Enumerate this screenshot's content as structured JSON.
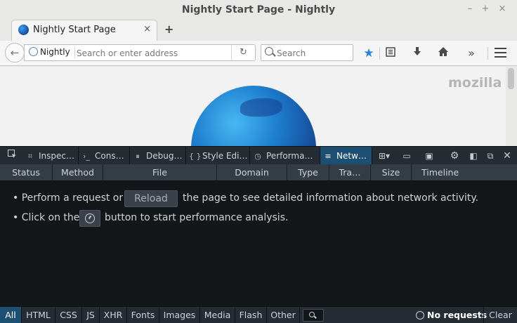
{
  "window": {
    "title": "Nightly Start Page - Nightly",
    "minimize_icon": "–",
    "maximize_icon": "+",
    "close_icon": "×"
  },
  "tabs": [
    {
      "label": "Nightly Start Page",
      "close": "×"
    }
  ],
  "new_tab_icon": "+",
  "navbar": {
    "identity_label": "Nightly",
    "url_placeholder": "Search or enter address",
    "search_placeholder": "Search"
  },
  "content": {
    "brand": "mozilla"
  },
  "devtools": {
    "tabs": [
      {
        "label": "Inspec…",
        "icon": "inspector-icon"
      },
      {
        "label": "Cons…",
        "icon": "console-icon"
      },
      {
        "label": "Debug…",
        "icon": "debugger-icon"
      },
      {
        "label": "Style Edi…",
        "icon": "style-editor-icon"
      },
      {
        "label": "Performa…",
        "icon": "performance-icon"
      },
      {
        "label": "Netw…",
        "icon": "network-icon",
        "active": true
      }
    ],
    "columns": [
      "Status",
      "Method",
      "File",
      "Domain",
      "Type",
      "Tra…",
      "Size",
      "Timeline"
    ],
    "messages": {
      "line1_prefix": "• Perform a request or",
      "reload_label": "Reload",
      "line1_suffix": "the page to see detailed information about network activity.",
      "line2_prefix": "• Click on the",
      "line2_suffix": "button to start performance analysis."
    },
    "filters": [
      "All",
      "HTML",
      "CSS",
      "JS",
      "XHR",
      "Fonts",
      "Images",
      "Media",
      "Flash",
      "Other"
    ],
    "active_filter": "All",
    "status": "No requests",
    "clear_label": "Clear"
  },
  "colors": {
    "devtools_bg": "#14171a",
    "devtools_toolbar": "#252c33",
    "active_tab": "#1d4f73",
    "bookmark_star": "#2a84d6"
  }
}
